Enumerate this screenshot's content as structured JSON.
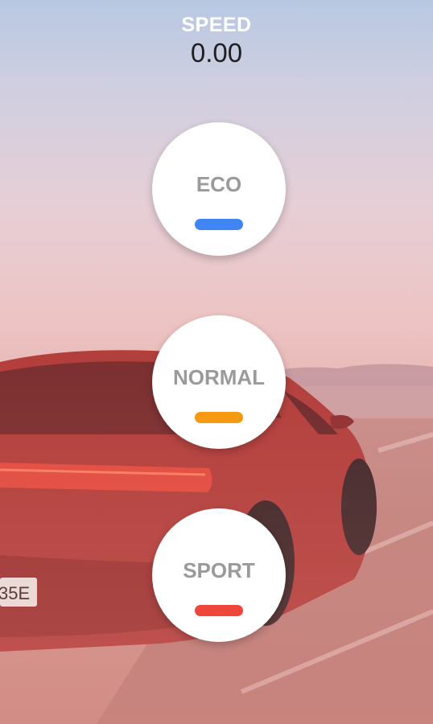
{
  "speed": {
    "label": "SPEED",
    "value": "0.00"
  },
  "modes": [
    {
      "label": "ECO",
      "indicator_color": "#3f86f4"
    },
    {
      "label": "NORMAL",
      "indicator_color": "#f59a12"
    },
    {
      "label": "SPORT",
      "indicator_color": "#ee463a"
    }
  ],
  "background": {
    "image": "red sports car on coastal road at dusk"
  }
}
